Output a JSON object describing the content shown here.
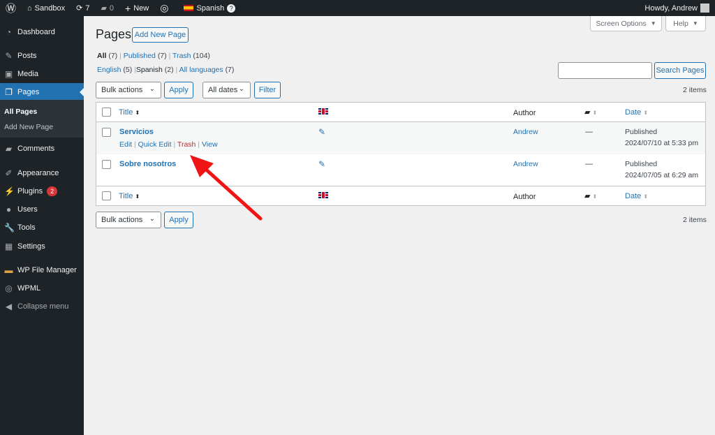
{
  "adminbar": {
    "site": "Sandbox",
    "updates": "7",
    "comments": "0",
    "new": "New",
    "language": "Spanish",
    "howdy": "Howdy, Andrew"
  },
  "sidebar": {
    "items": [
      {
        "label": "Dashboard"
      },
      {
        "label": "Posts"
      },
      {
        "label": "Media"
      },
      {
        "label": "Pages"
      },
      {
        "label": "Comments"
      },
      {
        "label": "Appearance"
      },
      {
        "label": "Plugins",
        "badge": "2"
      },
      {
        "label": "Users"
      },
      {
        "label": "Tools"
      },
      {
        "label": "Settings"
      },
      {
        "label": "WP File Manager"
      },
      {
        "label": "WPML"
      },
      {
        "label": "Collapse menu"
      }
    ],
    "submenu": [
      {
        "label": "All Pages"
      },
      {
        "label": "Add New Page"
      }
    ]
  },
  "header": {
    "title": "Pages",
    "add_new": "Add New Page",
    "screen_options": "Screen Options",
    "help": "Help"
  },
  "status_filters": [
    {
      "label": "All",
      "count": "(7)"
    },
    {
      "label": "Published",
      "count": "(7)"
    },
    {
      "label": "Trash",
      "count": "(104)"
    }
  ],
  "lang_filters": [
    {
      "label": "English",
      "count": "(5)"
    },
    {
      "label": "Spanish",
      "count": "(2)"
    },
    {
      "label": "All languages",
      "count": "(7)"
    }
  ],
  "search": {
    "value": "",
    "button": "Search Pages"
  },
  "toolbar": {
    "bulk": "Bulk actions",
    "apply": "Apply",
    "dates": "All dates",
    "filter": "Filter",
    "items": "2 items"
  },
  "table": {
    "columns": {
      "title": "Title",
      "author": "Author",
      "date": "Date"
    },
    "rows": [
      {
        "title": "Servicios",
        "author": "Andrew",
        "comments": "—",
        "status": "Published",
        "date": "2024/07/10 at 5:33 pm",
        "actions": [
          "Edit",
          "Quick Edit",
          "Trash",
          "View"
        ]
      },
      {
        "title": "Sobre nosotros",
        "author": "Andrew",
        "comments": "—",
        "status": "Published",
        "date": "2024/07/05 at 6:29 am"
      }
    ]
  }
}
